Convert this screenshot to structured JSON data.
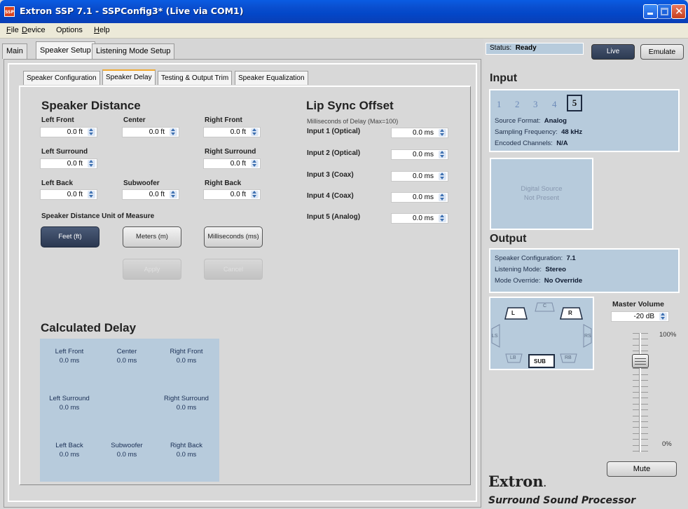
{
  "window": {
    "title": "Extron SSP 7.1 - SSPConfig3* (Live via COM1)",
    "icon": "SSP"
  },
  "menu": [
    {
      "label": "File",
      "u": "F",
      "rest": "ile"
    },
    {
      "label": "Device",
      "u": "D",
      "rest": "evice"
    },
    {
      "label": "Options",
      "u": "",
      "rest": "Options"
    },
    {
      "label": "Help",
      "u": "H",
      "rest": "elp"
    }
  ],
  "tabs": {
    "main": "Main",
    "speaker_setup": "Speaker Setup",
    "listening_mode": "Listening Mode Setup"
  },
  "subtabs": {
    "config": "Speaker Configuration",
    "delay": "Speaker Delay",
    "testing": "Testing & Output Trim",
    "eq": "Speaker Equalization"
  },
  "speaker_distance": {
    "title": "Speaker Distance",
    "left_front": {
      "label": "Left Front",
      "value": "0.0 ft"
    },
    "center": {
      "label": "Center",
      "value": "0.0 ft"
    },
    "right_front": {
      "label": "Right Front",
      "value": "0.0 ft"
    },
    "left_surround": {
      "label": "Left Surround",
      "value": "0.0 ft"
    },
    "right_surround": {
      "label": "Right Surround",
      "value": "0.0 ft"
    },
    "left_back": {
      "label": "Left Back",
      "value": "0.0 ft"
    },
    "subwoofer": {
      "label": "Subwoofer",
      "value": "0.0 ft"
    },
    "right_back": {
      "label": "Right Back",
      "value": "0.0 ft"
    },
    "unit_title": "Speaker Distance Unit of Measure",
    "units": {
      "feet": "Feet (ft)",
      "meters": "Meters (m)",
      "ms": "Milliseconds (ms)"
    },
    "selected_unit": "feet",
    "apply": "Apply",
    "cancel": "Cancel"
  },
  "lip_sync": {
    "title": "Lip Sync Offset",
    "subtitle": "Milliseconds of Delay (Max=100)",
    "inputs": [
      {
        "label": "Input 1 (Optical)",
        "value": "0.0 ms"
      },
      {
        "label": "Input 2 (Optical)",
        "value": "0.0 ms"
      },
      {
        "label": "Input 3 (Coax)",
        "value": "0.0 ms"
      },
      {
        "label": "Input 4 (Coax)",
        "value": "0.0 ms"
      },
      {
        "label": "Input 5 (Analog)",
        "value": "0.0 ms"
      }
    ]
  },
  "calculated_delay": {
    "title": "Calculated Delay",
    "left_front": {
      "label": "Left Front",
      "value": "0.0 ms"
    },
    "center": {
      "label": "Center",
      "value": "0.0 ms"
    },
    "right_front": {
      "label": "Right Front",
      "value": "0.0 ms"
    },
    "left_surround": {
      "label": "Left Surround",
      "value": "0.0 ms"
    },
    "right_surround": {
      "label": "Right Surround",
      "value": "0.0 ms"
    },
    "left_back": {
      "label": "Left Back",
      "value": "0.0 ms"
    },
    "subwoofer": {
      "label": "Subwoofer",
      "value": "0.0 ms"
    },
    "right_back": {
      "label": "Right Back",
      "value": "0.0 ms"
    }
  },
  "status": {
    "label": "Status:",
    "value": "Ready",
    "live": "Live",
    "emulate": "Emulate"
  },
  "input": {
    "title": "Input",
    "numbers": [
      "1",
      "2",
      "3",
      "4",
      "5"
    ],
    "selected": "5",
    "source_format_label": "Source Format:",
    "source_format": "Analog",
    "sampling_label": "Sampling Frequency:",
    "sampling": "48 kHz",
    "encoded_label": "Encoded Channels:",
    "encoded": "N/A",
    "digital_source_1": "Digital Source",
    "digital_source_2": "Not Present"
  },
  "output": {
    "title": "Output",
    "config_label": "Speaker Configuration:",
    "config": "7.1",
    "listening_label": "Listening Mode:",
    "listening": "Stereo",
    "override_label": "Mode Override:",
    "override": "No Override"
  },
  "speakers": {
    "l": "L",
    "c": "C",
    "r": "R",
    "ls": "LS",
    "rs": "RS",
    "lb": "LB",
    "sub": "SUB",
    "rb": "RB"
  },
  "master_volume": {
    "label": "Master Volume",
    "value": "-20 dB",
    "top": "100%",
    "bottom": "0%",
    "level_fraction": 0.8,
    "mute": "Mute"
  },
  "brand": {
    "name": "Extron",
    "product": "Surround Sound Processor"
  },
  "colors": {
    "titlebar": "#0a4fd0",
    "panel_blue": "#b7cbdc",
    "selected_button": "#2a3750",
    "tab_accent": "#f0a830"
  }
}
